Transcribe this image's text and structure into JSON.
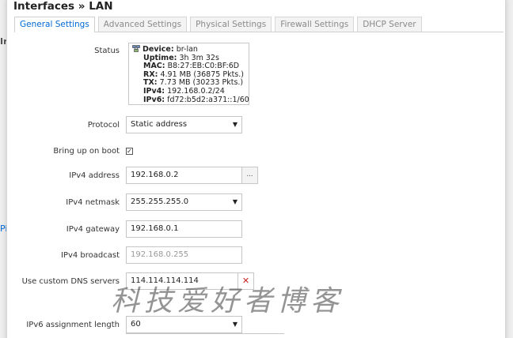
{
  "modal": {
    "title": "Interfaces » LAN",
    "tabs": [
      {
        "label": "General Settings",
        "active": true
      },
      {
        "label": "Advanced Settings",
        "active": false
      },
      {
        "label": "Physical Settings",
        "active": false
      },
      {
        "label": "Firewall Settings",
        "active": false
      },
      {
        "label": "DHCP Server",
        "active": false
      }
    ]
  },
  "status": {
    "label": "Status",
    "device_key": "Device:",
    "device_val": "br-lan",
    "uptime_key": "Uptime:",
    "uptime_val": "3h 3m 32s",
    "mac_key": "MAC:",
    "mac_val": "B8:27:EB:C0:BF:6D",
    "rx_key": "RX:",
    "rx_val": "4.91 MB (36875 Pkts.)",
    "tx_key": "TX:",
    "tx_val": "7.73 MB (30233 Pkts.)",
    "ipv4_key": "IPv4:",
    "ipv4_val": "192.168.0.2/24",
    "ipv6_key": "IPv6:",
    "ipv6_val": "fd72:b5d2:a371::1/60"
  },
  "form": {
    "protocol_label": "Protocol",
    "protocol_value": "Static address",
    "bringup_label": "Bring up on boot",
    "bringup_checked": true,
    "ipv4_address_label": "IPv4 address",
    "ipv4_address_value": "192.168.0.2",
    "ipv4_address_more": "...",
    "ipv4_netmask_label": "IPv4 netmask",
    "ipv4_netmask_value": "255.255.255.0",
    "ipv4_gateway_label": "IPv4 gateway",
    "ipv4_gateway_value": "192.168.0.1",
    "ipv4_broadcast_label": "IPv4 broadcast",
    "ipv4_broadcast_placeholder": "192.168.0.255",
    "dns_label": "Use custom DNS servers",
    "dns_value": "114.114.114.114",
    "dns_remove": "✕",
    "ipv6_len_label": "IPv6 assignment length",
    "ipv6_len_value": "60"
  },
  "watermark": "科技爱好者博客",
  "background": {
    "frag1": "Ir",
    "frag2": "Pi"
  }
}
